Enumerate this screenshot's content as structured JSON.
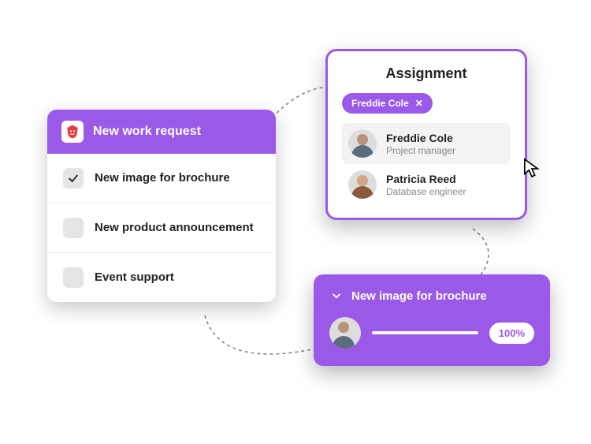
{
  "colors": {
    "purple": "#9b59e8"
  },
  "request_card": {
    "title": "New work request",
    "items": [
      {
        "label": "New image for brochure",
        "checked": true
      },
      {
        "label": "New product announcement",
        "checked": false
      },
      {
        "label": "Event support",
        "checked": false
      }
    ]
  },
  "assignment_card": {
    "title": "Assignment",
    "chip": {
      "label": "Freddie Cole"
    },
    "people": [
      {
        "name": "Freddie Cole",
        "role": "Project manager",
        "selected": true
      },
      {
        "name": "Patricia Reed",
        "role": "Database engineer",
        "selected": false
      }
    ]
  },
  "progress_card": {
    "title": "New image for brochure",
    "percent_label": "100%",
    "percent_value": 100
  }
}
